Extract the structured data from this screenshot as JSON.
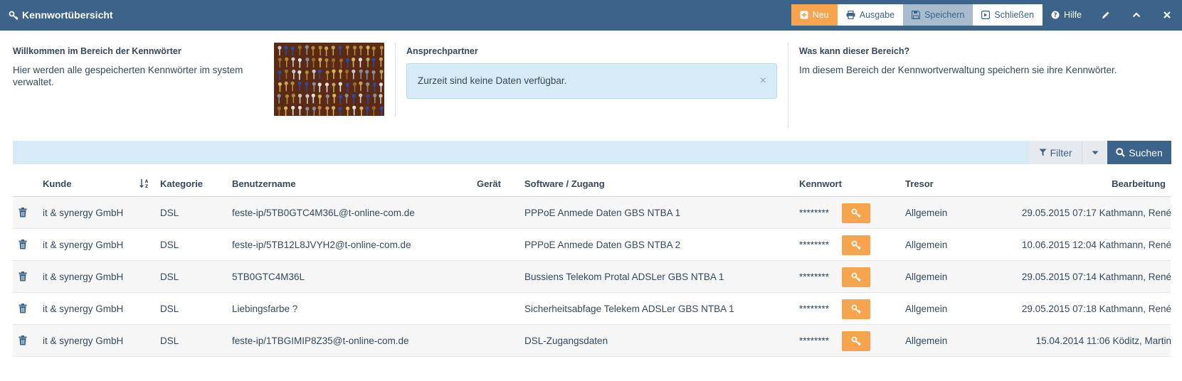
{
  "header": {
    "title": "Kennwortübersicht",
    "buttons": {
      "neu": "Neu",
      "ausgabe": "Ausgabe",
      "speichern": "Speichern",
      "schliessen": "Schließen",
      "hilfe": "Hilfe"
    }
  },
  "welcome": {
    "title": "Willkommen im Bereich der Kennwörter",
    "text": "Hier werden alle gespeicherten Kennwörter im system verwaltet."
  },
  "contact": {
    "title": "Ansprechpartner",
    "alert": "Zurzeit sind keine Daten verfügbar.",
    "alert_close": "×"
  },
  "about": {
    "title": "Was kann dieser Bereich?",
    "text": "Im diesem Bereich der Kennwortverwaltung speichern sie ihre Kennwörter."
  },
  "filterbar": {
    "filter_label": "Filter",
    "search_label": "Suchen"
  },
  "table": {
    "columns": {
      "kunde": "Kunde",
      "kategorie": "Kategorie",
      "benutzername": "Benutzername",
      "geraet": "Gerät",
      "software": "Software / Zugang",
      "kennwort": "Kennwort",
      "tresor": "Tresor",
      "bearbeitung": "Bearbeitung"
    },
    "rows": [
      {
        "kunde": "it & synergy GmbH",
        "kategorie": "DSL",
        "benutzername": "feste-ip/5TB0GTC4M36L@t-online-com.de",
        "geraet": "",
        "software": "PPPoE Anmede Daten GBS NTBA 1",
        "kennwort": "********",
        "tresor": "Allgemein",
        "bearbeitung": "29.05.2015 07:17 Kathmann, René"
      },
      {
        "kunde": "it & synergy GmbH",
        "kategorie": "DSL",
        "benutzername": "feste-ip/5TB12L8JVYH2@t-online-com.de",
        "geraet": "",
        "software": "PPPoE Anmede Daten GBS NTBA 2",
        "kennwort": "********",
        "tresor": "Allgemein",
        "bearbeitung": "10.06.2015 12:04 Kathmann, René"
      },
      {
        "kunde": "it & synergy GmbH",
        "kategorie": "DSL",
        "benutzername": "5TB0GTC4M36L",
        "geraet": "",
        "software": "Bussiens Telekom Protal ADSLer GBS NTBA 1",
        "kennwort": "********",
        "tresor": "Allgemein",
        "bearbeitung": "29.05.2015 07:14 Kathmann, René"
      },
      {
        "kunde": "it & synergy GmbH",
        "kategorie": "DSL",
        "benutzername": "Liebingsfarbe ?",
        "geraet": "",
        "software": "Sicherheitsabfage Telekem ADSLer GBS NTBA 1",
        "kennwort": "********",
        "tresor": "Allgemein",
        "bearbeitung": "29.05.2015 07:18 Kathmann, René"
      },
      {
        "kunde": "it & synergy GmbH",
        "kategorie": "DSL",
        "benutzername": "feste-ip/1TBGIMIP8Z35@t-online-com.de",
        "geraet": "",
        "software": "DSL-Zugangsdaten",
        "kennwort": "********",
        "tresor": "Allgemein",
        "bearbeitung": "15.04.2014 11:06 Köditz, Martin"
      }
    ]
  },
  "colors": {
    "header_bg": "#3c6389",
    "accent_orange": "#f6a44d",
    "info_bg": "#d6ebf5"
  }
}
